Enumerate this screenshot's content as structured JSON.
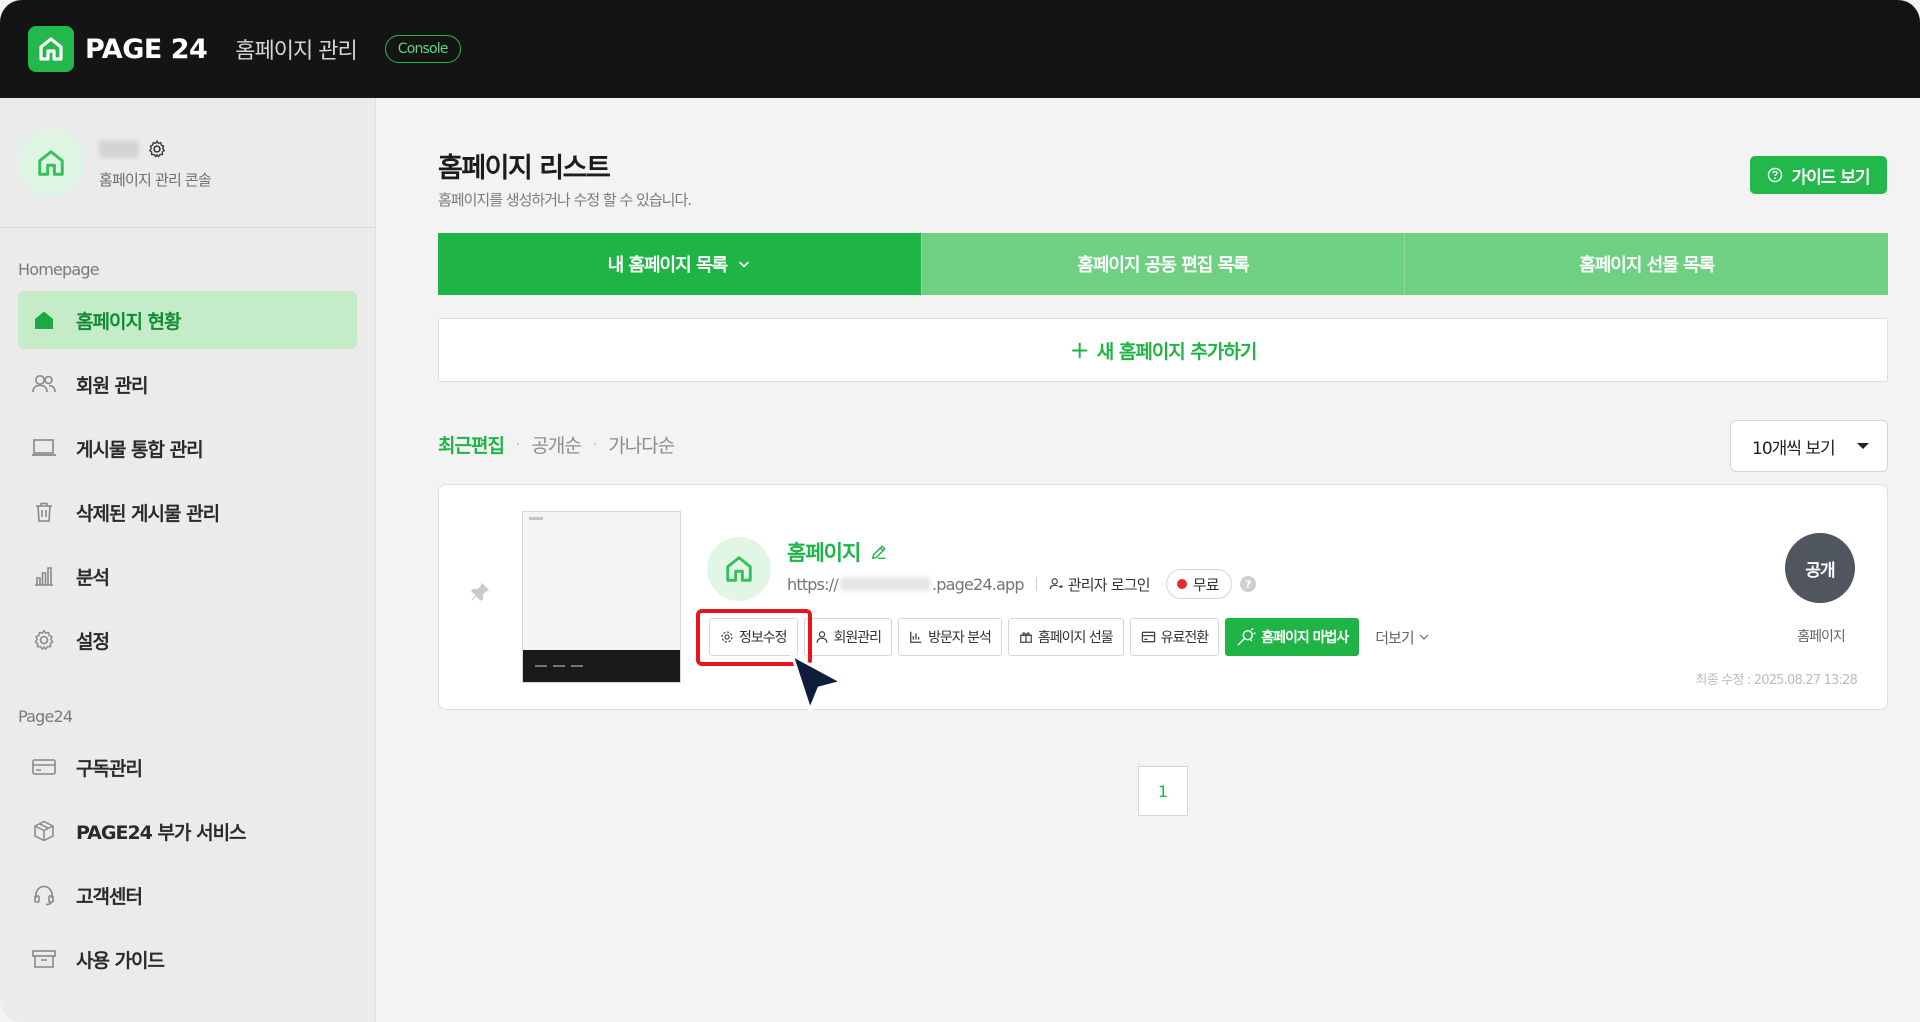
{
  "topbar": {
    "logo_text": "PAGE 24",
    "title": "홈페이지 관리",
    "badge": "Console",
    "accent_color": "#22b84c"
  },
  "profile": {
    "subtitle": "홈페이지 관리 콘솔"
  },
  "sidebar": {
    "section_homepage": "Homepage",
    "section_page24": "Page24",
    "homepage_items": [
      {
        "label": "홈페이지 현황",
        "icon": "home-icon",
        "active": true
      },
      {
        "label": "회원 관리",
        "icon": "users-icon"
      },
      {
        "label": "게시물 통합 관리",
        "icon": "laptop-icon"
      },
      {
        "label": "삭제된 게시물 관리",
        "icon": "trash-icon"
      },
      {
        "label": "분석",
        "icon": "bar-chart-icon"
      },
      {
        "label": "설정",
        "icon": "gear-icon"
      }
    ],
    "page24_items": [
      {
        "label": "구독관리",
        "icon": "credit-card-icon"
      },
      {
        "label": "PAGE24 부가 서비스",
        "icon": "box-icon"
      },
      {
        "label": "고객센터",
        "icon": "headset-icon"
      },
      {
        "label": "사용 가이드",
        "icon": "archive-icon"
      }
    ]
  },
  "main": {
    "title": "홈페이지 리스트",
    "subtitle": "홈페이지를 생성하거나 수정 할 수 있습니다.",
    "guide_button": "가이드 보기",
    "tabs": [
      {
        "label": "내 홈페이지 목록",
        "active": true
      },
      {
        "label": "홈페이지 공동 편집 목록"
      },
      {
        "label": "홈페이지 선물 목록"
      }
    ],
    "add_button": "새 홈페이지 추가하기",
    "sort_options": [
      "최근편집",
      "공개순",
      "가나다순"
    ],
    "per_page": "10개씩 보기",
    "pagination": [
      "1"
    ]
  },
  "site_card": {
    "name": "홈페이지",
    "url_prefix": "https://",
    "url_suffix": ".page24.app",
    "admin_login": "관리자 로그인",
    "plan": "무료",
    "help": "?",
    "actions": [
      {
        "label": "정보수정",
        "icon": "settings-icon"
      },
      {
        "label": "회원관리",
        "icon": "user-icon"
      },
      {
        "label": "방문자 분석",
        "icon": "chart-icon"
      },
      {
        "label": "홈페이지 선물",
        "icon": "gift-icon"
      },
      {
        "label": "유료전환",
        "icon": "card-icon"
      },
      {
        "label": "홈페이지 마법사",
        "icon": "magic-wand-icon",
        "primary": true
      }
    ],
    "more": "더보기",
    "status": "공개",
    "status_caption": "홈페이지",
    "last_edit": "최종 수정 : 2025.08.27 13:28"
  }
}
